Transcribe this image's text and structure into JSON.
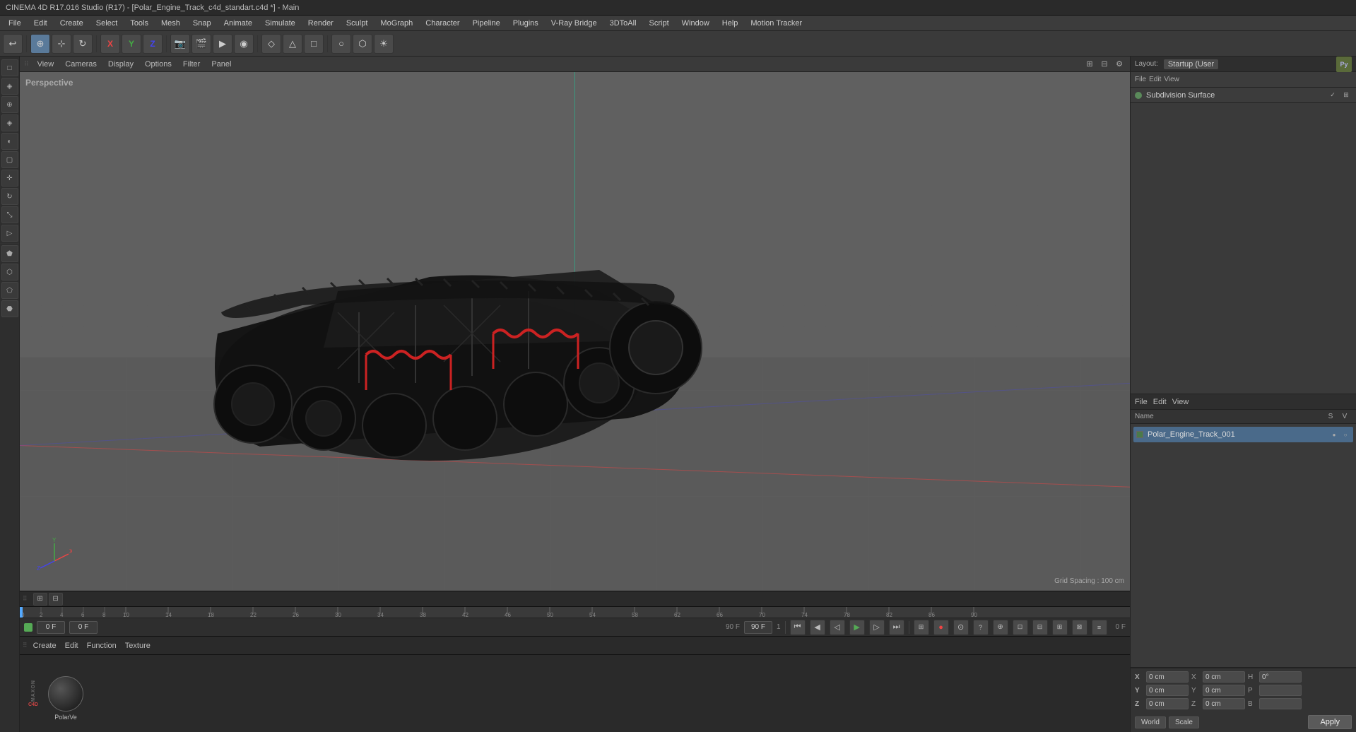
{
  "window": {
    "title": "CINEMA 4D R17.016 Studio (R17) - [Polar_Engine_Track_c4d_standart.c4d *] - Main"
  },
  "menu_bar": {
    "items": [
      "File",
      "Edit",
      "Create",
      "Select",
      "Tools",
      "Mesh",
      "Snap",
      "Animate",
      "Simulate",
      "Render",
      "Sculpt",
      "MoGraph",
      "Character",
      "Pipeline",
      "Plugins",
      "V-Ray Bridge",
      "3DToAll",
      "Script",
      "Window",
      "Help"
    ]
  },
  "viewport": {
    "label": "Perspective",
    "grid_spacing": "Grid Spacing : 100 cm",
    "view_menu": [
      "View",
      "Cameras",
      "Display",
      "Options",
      "Filter",
      "Panel"
    ]
  },
  "right_panel": {
    "layout_label": "Layout:",
    "layout_value": "Startup (User",
    "subdivision_surface": "Subdivision Surface",
    "object_list": {
      "columns": {
        "name": "Name",
        "s": "S",
        "v": "V"
      },
      "menu": [
        "File",
        "Edit",
        "View"
      ],
      "items": [
        {
          "name": "Polar_Engine_Track_001",
          "color": "#4a7a4a"
        }
      ]
    }
  },
  "timeline": {
    "frame_start": "0 F",
    "frame_current": "0 F",
    "frame_end": "90 F",
    "fps": "1",
    "range_start": "0",
    "range_end": "90 F",
    "playback_fps": "90 F"
  },
  "material_bar": {
    "menus": [
      "Create",
      "Edit",
      "Function",
      "Texture"
    ],
    "material_name": "PolarVe"
  },
  "coordinates": {
    "x_pos": "0 cm",
    "y_pos": "0 cm",
    "z_pos": "0 cm",
    "x_size": "0 cm",
    "y_size": "0 cm",
    "z_size": "0 cm",
    "h_rot": "0°",
    "p_rot": "",
    "b_rot": "",
    "mode_world": "World",
    "mode_scale": "Scale",
    "apply_btn": "Apply"
  },
  "toolbar": {
    "icons": [
      "↩",
      "⊕",
      "○",
      "↺",
      "✕",
      "○",
      "□",
      "□",
      "▷",
      "□",
      "□",
      "□",
      "□",
      "□",
      "□",
      "□"
    ]
  }
}
